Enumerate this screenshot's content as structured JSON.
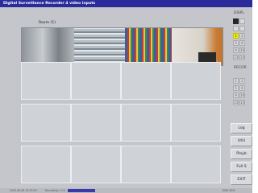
{
  "window": {
    "title": "Digital Surveillance Recorder 4 video inputs"
  },
  "camera1": {
    "label": "Room (1)"
  },
  "sidebar": {
    "display_header": "DISPL",
    "record_header": "RECOR",
    "display_rows": [
      [
        "",
        ""
      ],
      [
        "",
        ""
      ],
      [
        "1",
        "2"
      ],
      [
        "5",
        "6"
      ],
      [
        "9",
        "10"
      ],
      [
        "13",
        "14"
      ]
    ],
    "record_rows": [
      [
        "1",
        "2"
      ],
      [
        "5",
        "6"
      ],
      [
        "9",
        "10"
      ],
      [
        "13",
        "14"
      ]
    ],
    "buttons": [
      "Log",
      "Utili",
      "Playb",
      "Full S",
      "EXIT"
    ]
  },
  "statusbar": {
    "items": [
      "2005.08.06 13:33:00",
      "Recording: 4 ch",
      "",
      "DISK 80%"
    ]
  },
  "colors": {
    "titlebar": "#2b2b9c",
    "selected": "#f3f100",
    "panel": "#c4c6cb"
  }
}
